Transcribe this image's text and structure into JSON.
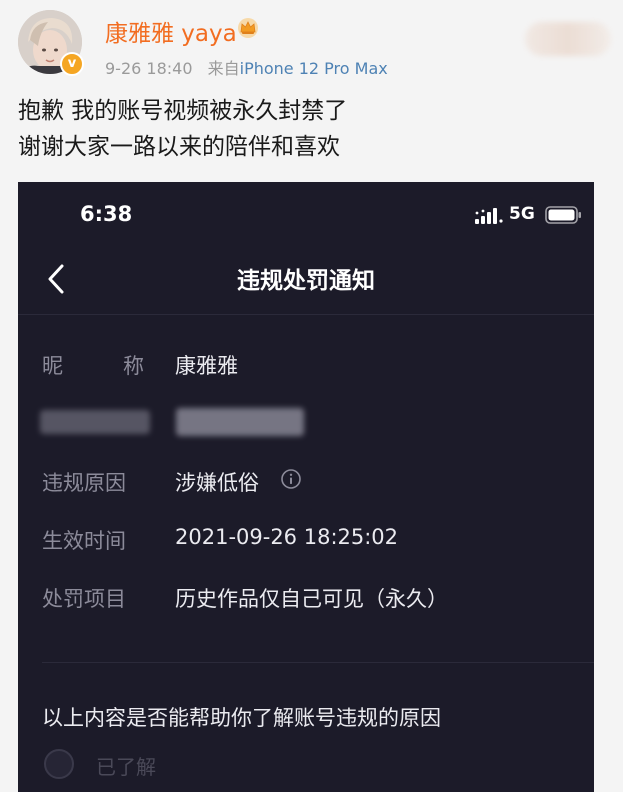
{
  "post": {
    "username": "康雅雅 yaya",
    "timestamp": "9-26 18:40",
    "source_prefix": "来自",
    "device": "iPhone 12 Pro Max",
    "text_line1": "抱歉 我的账号视频被永久封禁了",
    "text_line2": "谢谢大家一路以来的陪伴和喜欢",
    "verify_badge": "v",
    "accent_color": "#f26d21"
  },
  "phone": {
    "status": {
      "time": "6:38",
      "network": "5G"
    },
    "nav": {
      "title": "违规处罚通知"
    },
    "info": {
      "nickname_label_chars": [
        "昵",
        "称"
      ],
      "nickname_value": "康雅雅",
      "reason_label": "违规原因",
      "reason_value": "涉嫌低俗",
      "time_label": "生效时间",
      "time_value": "2021-09-26 18:25:02",
      "penalty_label": "处罚项目",
      "penalty_value": "历史作品仅自己可见（永久）"
    },
    "feedback": {
      "question": "以上内容是否能帮助你了解账号违规的原因",
      "option1": "已了解"
    },
    "background_color": "#1c1b29"
  }
}
